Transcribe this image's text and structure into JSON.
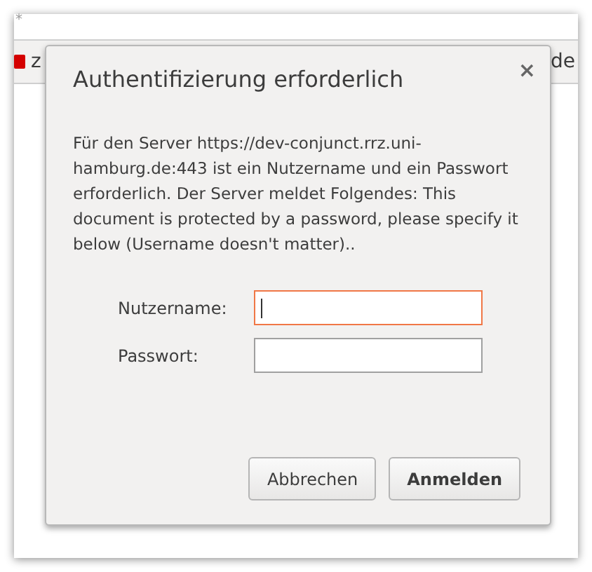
{
  "browser": {
    "title_mark": "*",
    "tabs": [
      {
        "label": "z",
        "kind": "favicon"
      },
      {
        "label": "de",
        "kind": "plain"
      }
    ]
  },
  "dialog": {
    "title": "Authentifizierung erforderlich",
    "close": "×",
    "message": "Für den Server https://dev-conjunct.rrz.uni-hamburg.de:443 ist ein Nutzername und ein Passwort erforderlich. Der Server meldet Folgendes: This document is protected by a password, please specify it below (Username doesn't matter)..",
    "fields": [
      {
        "label": "Nutzername:",
        "focused": true
      },
      {
        "label": "Passwort:",
        "focused": false
      }
    ],
    "buttons": [
      {
        "label": "Abbrechen",
        "default": false
      },
      {
        "label": "Anmelden",
        "default": true
      }
    ]
  }
}
